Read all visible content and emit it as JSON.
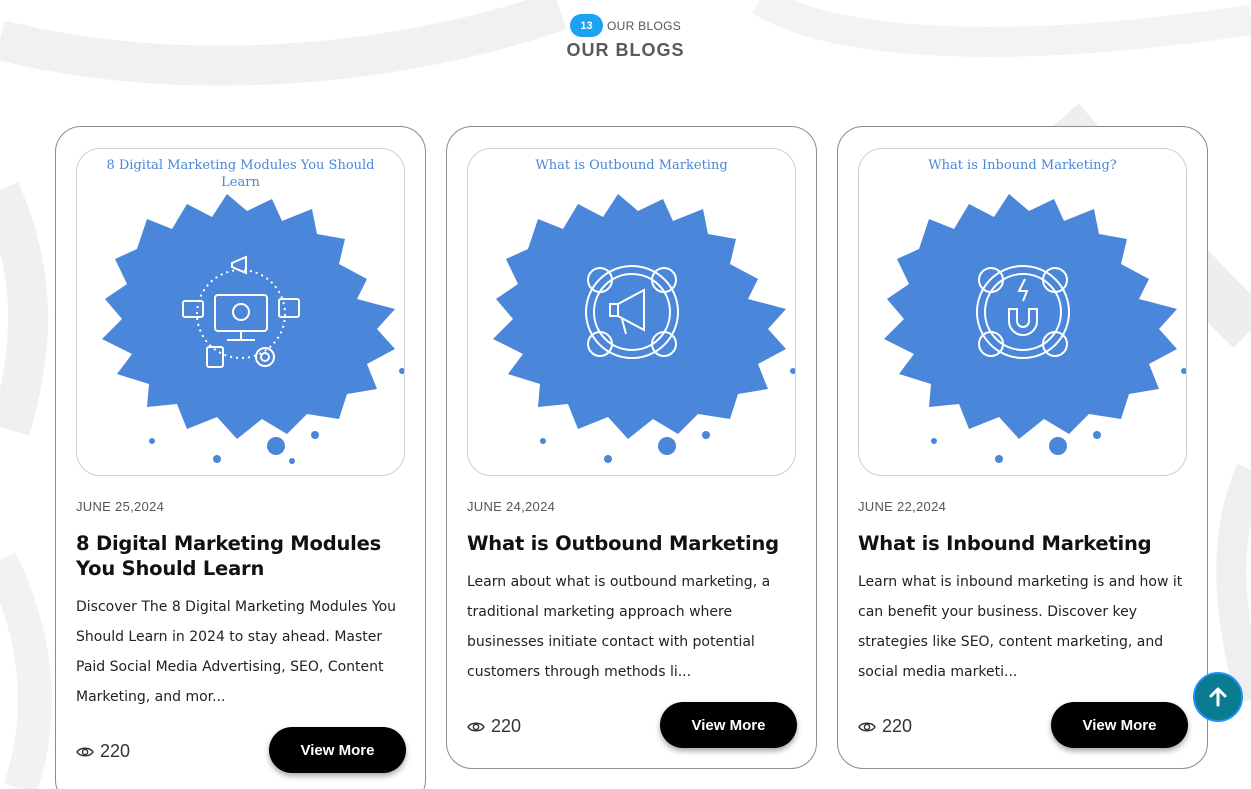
{
  "header": {
    "badge": "13",
    "eyebrow": "OUR BLOGS",
    "title": "OUR BLOGS"
  },
  "colors": {
    "accent_blue": "#1da1f2",
    "splash_blue": "#4a86d9",
    "button_black": "#000000",
    "scroll_top_teal": "#0b7b8f"
  },
  "cards": [
    {
      "thumb_caption": "8 Digital Marketing Modules You Should Learn",
      "thumb_icon": "digital-marketing-modules-icon",
      "date": "JUNE 25,2024",
      "title": "8 Digital Marketing Modules You Should Learn",
      "excerpt": "Discover The 8 Digital Marketing Modules You Should Learn in 2024 to stay ahead. Master Paid Social Media Advertising, SEO, Content Marketing, and mor...",
      "views": "220",
      "button": "View More"
    },
    {
      "thumb_caption": "What is Outbound Marketing",
      "thumb_icon": "megaphone-people-icon",
      "date": "JUNE 24,2024",
      "title": "What is Outbound Marketing",
      "excerpt": "Learn about what is outbound marketing, a traditional marketing approach where businesses initiate contact with potential customers through methods li...",
      "views": "220",
      "button": "View More"
    },
    {
      "thumb_caption": "What is Inbound Marketing?",
      "thumb_icon": "magnet-people-icon",
      "date": "JUNE 22,2024",
      "title": "What is Inbound Marketing",
      "excerpt": "Learn what is inbound marketing is and how it can benefit your business. Discover key strategies like SEO, content marketing, and social media marketi...",
      "views": "220",
      "button": "View More"
    }
  ],
  "scroll_top_icon": "arrow-up-icon"
}
